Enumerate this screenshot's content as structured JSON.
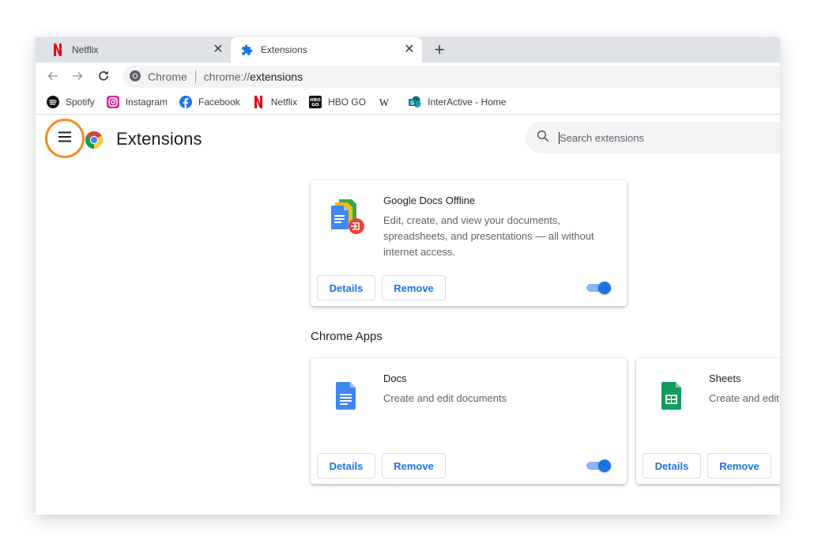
{
  "tabs": [
    {
      "label": "Netflix",
      "active": false,
      "icon": "netflix-icon"
    },
    {
      "label": "Extensions",
      "active": true,
      "icon": "puzzle-icon"
    }
  ],
  "toolbar": {
    "omnibox_site": "Chrome",
    "url_prefix": "chrome://",
    "url_host": "extensions"
  },
  "bookmarks": [
    {
      "label": "Spotify",
      "icon": "spotify-icon"
    },
    {
      "label": "Instagram",
      "icon": "instagram-icon"
    },
    {
      "label": "Facebook",
      "icon": "facebook-icon"
    },
    {
      "label": "Netflix",
      "icon": "netflix-icon"
    },
    {
      "label": "HBO GO",
      "icon": "hbo-go-icon"
    },
    {
      "label": "",
      "icon": "wikipedia-icon"
    },
    {
      "label": "InterActive - Home",
      "icon": "sharepoint-icon"
    }
  ],
  "page": {
    "title": "Extensions",
    "search_placeholder": "Search extensions"
  },
  "extensions": [
    {
      "name": "Google Docs Offline",
      "description": "Edit, create, and view your documents, spreadsheets, and presentations — all without internet access.",
      "details_label": "Details",
      "remove_label": "Remove",
      "enabled": true
    }
  ],
  "chrome_apps": {
    "section_title": "Chrome Apps",
    "items": [
      {
        "name": "Docs",
        "description": "Create and edit documents",
        "details_label": "Details",
        "remove_label": "Remove",
        "enabled": true
      },
      {
        "name": "Sheets",
        "description": "Create and edit spreadsheets",
        "details_label": "Details",
        "remove_label": "Remove",
        "enabled": true
      }
    ]
  },
  "colors": {
    "accent": "#1a73e8",
    "highlight_ring": "#f78c1e",
    "tabstrip": "#dee1e6"
  }
}
